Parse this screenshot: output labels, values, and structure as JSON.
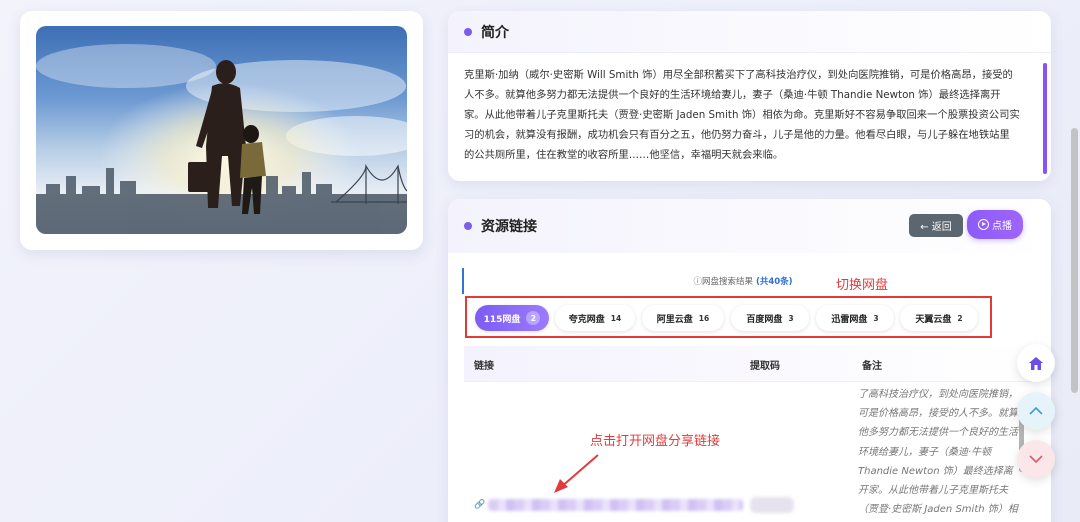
{
  "intro": {
    "title": "简介",
    "text": "克里斯·加纳（威尔·史密斯 Will Smith 饰）用尽全部积蓄买下了高科技治疗仪，到处向医院推销，可是价格高昂，接受的人不多。就算他多努力都无法提供一个良好的生活环境给妻儿，妻子（桑迪·牛顿 Thandie Newton 饰）最终选择离开家。从此他带着儿子克里斯托夫（贾登·史密斯 Jaden Smith 饰）相依为命。克里斯好不容易争取回来一个股票投资公司实习的机会，就算没有报酬，成功机会只有百分之五，他仍努力奋斗，儿子是他的力量。他看尽白眼，与儿子躲在地铁站里的公共厕所里，住在教堂的收容所里……他坚信，幸福明天就会来临。"
  },
  "resources": {
    "title": "资源链接",
    "back_label": "← 返回",
    "play_label": "点播",
    "search_label": "ⓘ网盘搜索结果",
    "search_count": "(共40条)",
    "switch_annotation": "切换网盘",
    "tabs": [
      {
        "label": "115网盘",
        "count": "2",
        "active": true
      },
      {
        "label": "夸克网盘",
        "count": "14"
      },
      {
        "label": "阿里云盘",
        "count": "16"
      },
      {
        "label": "百度网盘",
        "count": "3"
      },
      {
        "label": "迅雷网盘",
        "count": "3"
      },
      {
        "label": "天翼云盘",
        "count": "2"
      }
    ],
    "columns": {
      "link": "链接",
      "code": "提取码",
      "remark": "备注"
    },
    "row": {
      "remark": "了高科技治疗仪，到处向医院推销，可是价格高昂，接受的人不多。就算他多努力都无法提供一个良好的生活环境给妻儿，妻子（桑迪·牛顿 Thandie Newton 饰）最终选择离开家。从此他带着儿子克里斯托夫（贾登·史密斯 Jaden Smith 饰）相依为命。克里斯好不"
    },
    "click_annotation": "点击打开网盘分享链接"
  },
  "colors": {
    "accent": "#7b5cf0",
    "annotation": "#e23b3b",
    "back": "#5c6670"
  },
  "icons": {
    "home": "home-icon",
    "up": "chevron-up-icon",
    "down": "chevron-down-icon",
    "link": "link-icon"
  }
}
